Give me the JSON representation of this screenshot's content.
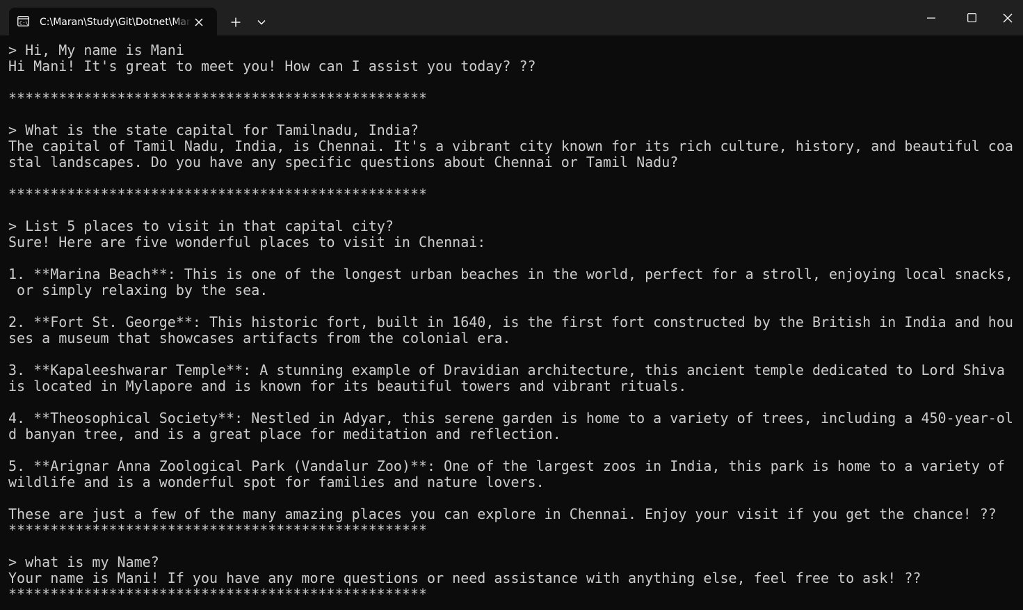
{
  "tab": {
    "icon": "terminal-icon",
    "title": "C:\\Maran\\Study\\Git\\Dotnet\\Mani"
  },
  "icons": {
    "close_tab": "close-icon",
    "new_tab": "plus-icon",
    "dropdown": "chevron-down-icon",
    "minimize": "minimize-icon",
    "maximize": "maximize-icon",
    "close_window": "close-icon"
  },
  "colors": {
    "background": "#0c0c0c",
    "titlebar": "#202020",
    "text": "#cccccc"
  },
  "terminal": {
    "lines": [
      "> Hi, My name is Mani",
      "Hi Mani! It's great to meet you! How can I assist you today? ??",
      "",
      "**************************************************",
      "",
      "> What is the state capital for Tamilnadu, India?",
      "The capital of Tamil Nadu, India, is Chennai. It's a vibrant city known for its rich culture, history, and beautiful coa",
      "stal landscapes. Do you have any specific questions about Chennai or Tamil Nadu?",
      "",
      "**************************************************",
      "",
      "> List 5 places to visit in that capital city?",
      "Sure! Here are five wonderful places to visit in Chennai:",
      "",
      "1. **Marina Beach**: This is one of the longest urban beaches in the world, perfect for a stroll, enjoying local snacks,",
      " or simply relaxing by the sea.",
      "",
      "2. **Fort St. George**: This historic fort, built in 1640, is the first fort constructed by the British in India and hou",
      "ses a museum that showcases artifacts from the colonial era.",
      "",
      "3. **Kapaleeshwarar Temple**: A stunning example of Dravidian architecture, this ancient temple dedicated to Lord Shiva",
      "is located in Mylapore and is known for its beautiful towers and vibrant rituals.",
      "",
      "4. **Theosophical Society**: Nestled in Adyar, this serene garden is home to a variety of trees, including a 450-year-ol",
      "d banyan tree, and is a great place for meditation and reflection.",
      "",
      "5. **Arignar Anna Zoological Park (Vandalur Zoo)**: One of the largest zoos in India, this park is home to a variety of",
      "wildlife and is a wonderful spot for families and nature lovers.",
      "",
      "These are just a few of the many amazing places you can explore in Chennai. Enjoy your visit if you get the chance! ??",
      "**************************************************",
      "",
      "> what is my Name?",
      "Your name is Mani! If you have any more questions or need assistance with anything else, feel free to ask! ??",
      "**************************************************"
    ]
  }
}
